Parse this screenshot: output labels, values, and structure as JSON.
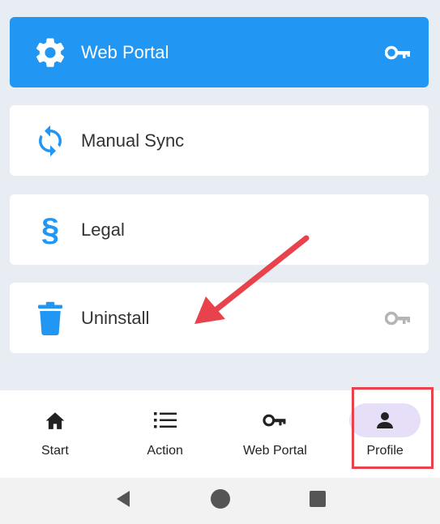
{
  "menu": {
    "items": [
      {
        "label": "Web Portal",
        "icon": "gear-icon",
        "trailing_icon": "key-icon"
      },
      {
        "label": "Manual Sync",
        "icon": "sync-icon"
      },
      {
        "label": "Legal",
        "icon": "section-sign-icon",
        "glyph": "§"
      },
      {
        "label": "Uninstall",
        "icon": "trash-icon",
        "trailing_icon": "key-icon"
      }
    ]
  },
  "bottom_nav": {
    "items": [
      {
        "label": "Start",
        "icon": "home-icon"
      },
      {
        "label": "Action",
        "icon": "list-icon"
      },
      {
        "label": "Web Portal",
        "icon": "key-icon"
      },
      {
        "label": "Profile",
        "icon": "person-icon",
        "active": true
      }
    ]
  },
  "colors": {
    "primary": "#2196f3",
    "background": "#e8ecf3",
    "annotation": "#e8434d",
    "active_pill": "#e7def7"
  }
}
